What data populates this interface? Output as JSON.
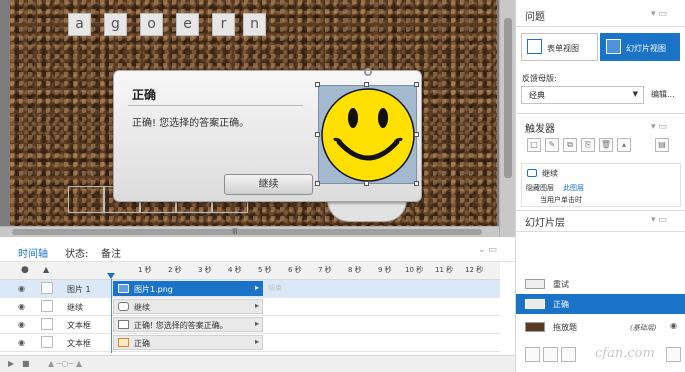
{
  "stage": {
    "letter_tiles": [
      "a",
      "g",
      "o",
      "e",
      "r",
      "n"
    ],
    "dialog": {
      "title": "正确",
      "message": "正确! 您选择的答案正确。",
      "continue_label": "继续"
    }
  },
  "timeline": {
    "tabs": [
      {
        "label": "时间轴",
        "active": true
      },
      {
        "label": "状态:",
        "active": false
      },
      {
        "label": "备注",
        "active": false
      }
    ],
    "ticks": [
      "1 秒",
      "2 秒",
      "3 秒",
      "4 秒",
      "5 秒",
      "6 秒",
      "7 秒",
      "8 秒",
      "9 秒",
      "10 秒",
      "11 秒",
      "12 秒"
    ],
    "rows": [
      {
        "name": "图片 1",
        "bar_label": "图片1.png",
        "selected": true,
        "ghost": "结束"
      },
      {
        "name": "继续",
        "bar_label": "继续",
        "selected": false,
        "ghost": ""
      },
      {
        "name": "文本框",
        "bar_label": "正确! 您选择的答案正确。",
        "selected": false,
        "ghost": ""
      },
      {
        "name": "文本框",
        "bar_label": "正确",
        "selected": false,
        "ghost": ""
      }
    ]
  },
  "right_panel": {
    "question_title": "问题",
    "form_view_label": "表单视图",
    "slide_view_label": "幻灯片视图",
    "feedback_master_label": "反馈母版:",
    "master_value": "经典",
    "edit_label": "编辑...",
    "triggers_title": "触发器",
    "trigger_item": "继续",
    "trigger_action": "隐藏图层",
    "trigger_target": "此图层",
    "trigger_condition": "当用户单击时",
    "layers_title": "幻灯片层",
    "layers": [
      {
        "name": "重试",
        "active": false
      },
      {
        "name": "正确",
        "active": true
      },
      {
        "name": "拖放题",
        "active": false,
        "tag": "(基础层)"
      }
    ]
  },
  "watermark": "cfan.com"
}
